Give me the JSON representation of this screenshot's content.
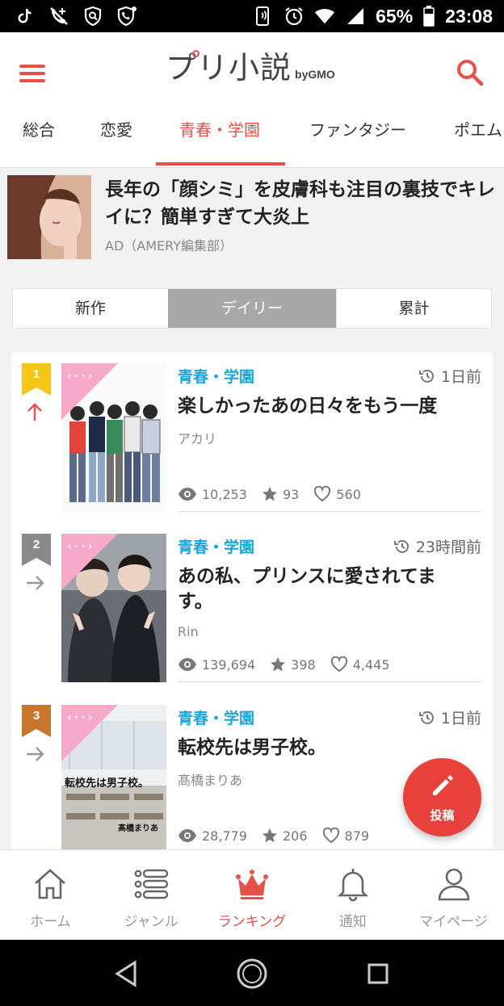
{
  "status_bar": {
    "battery": "65%",
    "time": "23:08"
  },
  "header": {
    "logo_main": "プリ小説",
    "logo_sub": "byGMO"
  },
  "tabs": [
    {
      "label": "総合"
    },
    {
      "label": "恋愛"
    },
    {
      "label": "青春・学園",
      "active": true
    },
    {
      "label": "ファンタジー"
    },
    {
      "label": "ポエム"
    }
  ],
  "ad": {
    "title": "長年の「顔シミ」を皮膚科も注目の裏技でキレイに？簡単すぎて大炎上",
    "meta": "AD（AMERY編集部）"
  },
  "segments": [
    {
      "label": "新作"
    },
    {
      "label": "デイリー",
      "active": true
    },
    {
      "label": "累計"
    }
  ],
  "ranking": [
    {
      "rank": "1",
      "badge_color": "#f5c518",
      "trend": "up",
      "genre": "青春・学園",
      "time": "1日前",
      "title": "楽しかったあの日々をもう一度",
      "author": "アカリ",
      "views": "10,253",
      "stars": "93",
      "likes": "560"
    },
    {
      "rank": "2",
      "badge_color": "#8a8a8a",
      "trend": "flat",
      "genre": "青春・学園",
      "time": "23時間前",
      "title": "あの私、プリンスに愛されてます。",
      "author": "Rin",
      "views": "139,694",
      "stars": "398",
      "likes": "4,445"
    },
    {
      "rank": "3",
      "badge_color": "#c8752e",
      "trend": "flat",
      "genre": "青春・学園",
      "time": "1日前",
      "title": "転校先は男子校。",
      "author": "髙橋まりあ",
      "views": "28,779",
      "stars": "206",
      "likes": "879",
      "cover_title": "転校先は男子校。",
      "cover_author": "髙橋まりあ"
    }
  ],
  "fab": {
    "label": "投稿"
  },
  "bottom_nav": [
    {
      "label": "ホーム",
      "icon": "home-icon"
    },
    {
      "label": "ジャンル",
      "icon": "list-icon"
    },
    {
      "label": "ランキング",
      "icon": "crown-icon",
      "active": true
    },
    {
      "label": "通知",
      "icon": "bell-icon"
    },
    {
      "label": "マイページ",
      "icon": "person-icon"
    }
  ],
  "colors": {
    "accent": "#e8504a",
    "genre": "#1ba5d8",
    "fab": "#e8403a"
  }
}
